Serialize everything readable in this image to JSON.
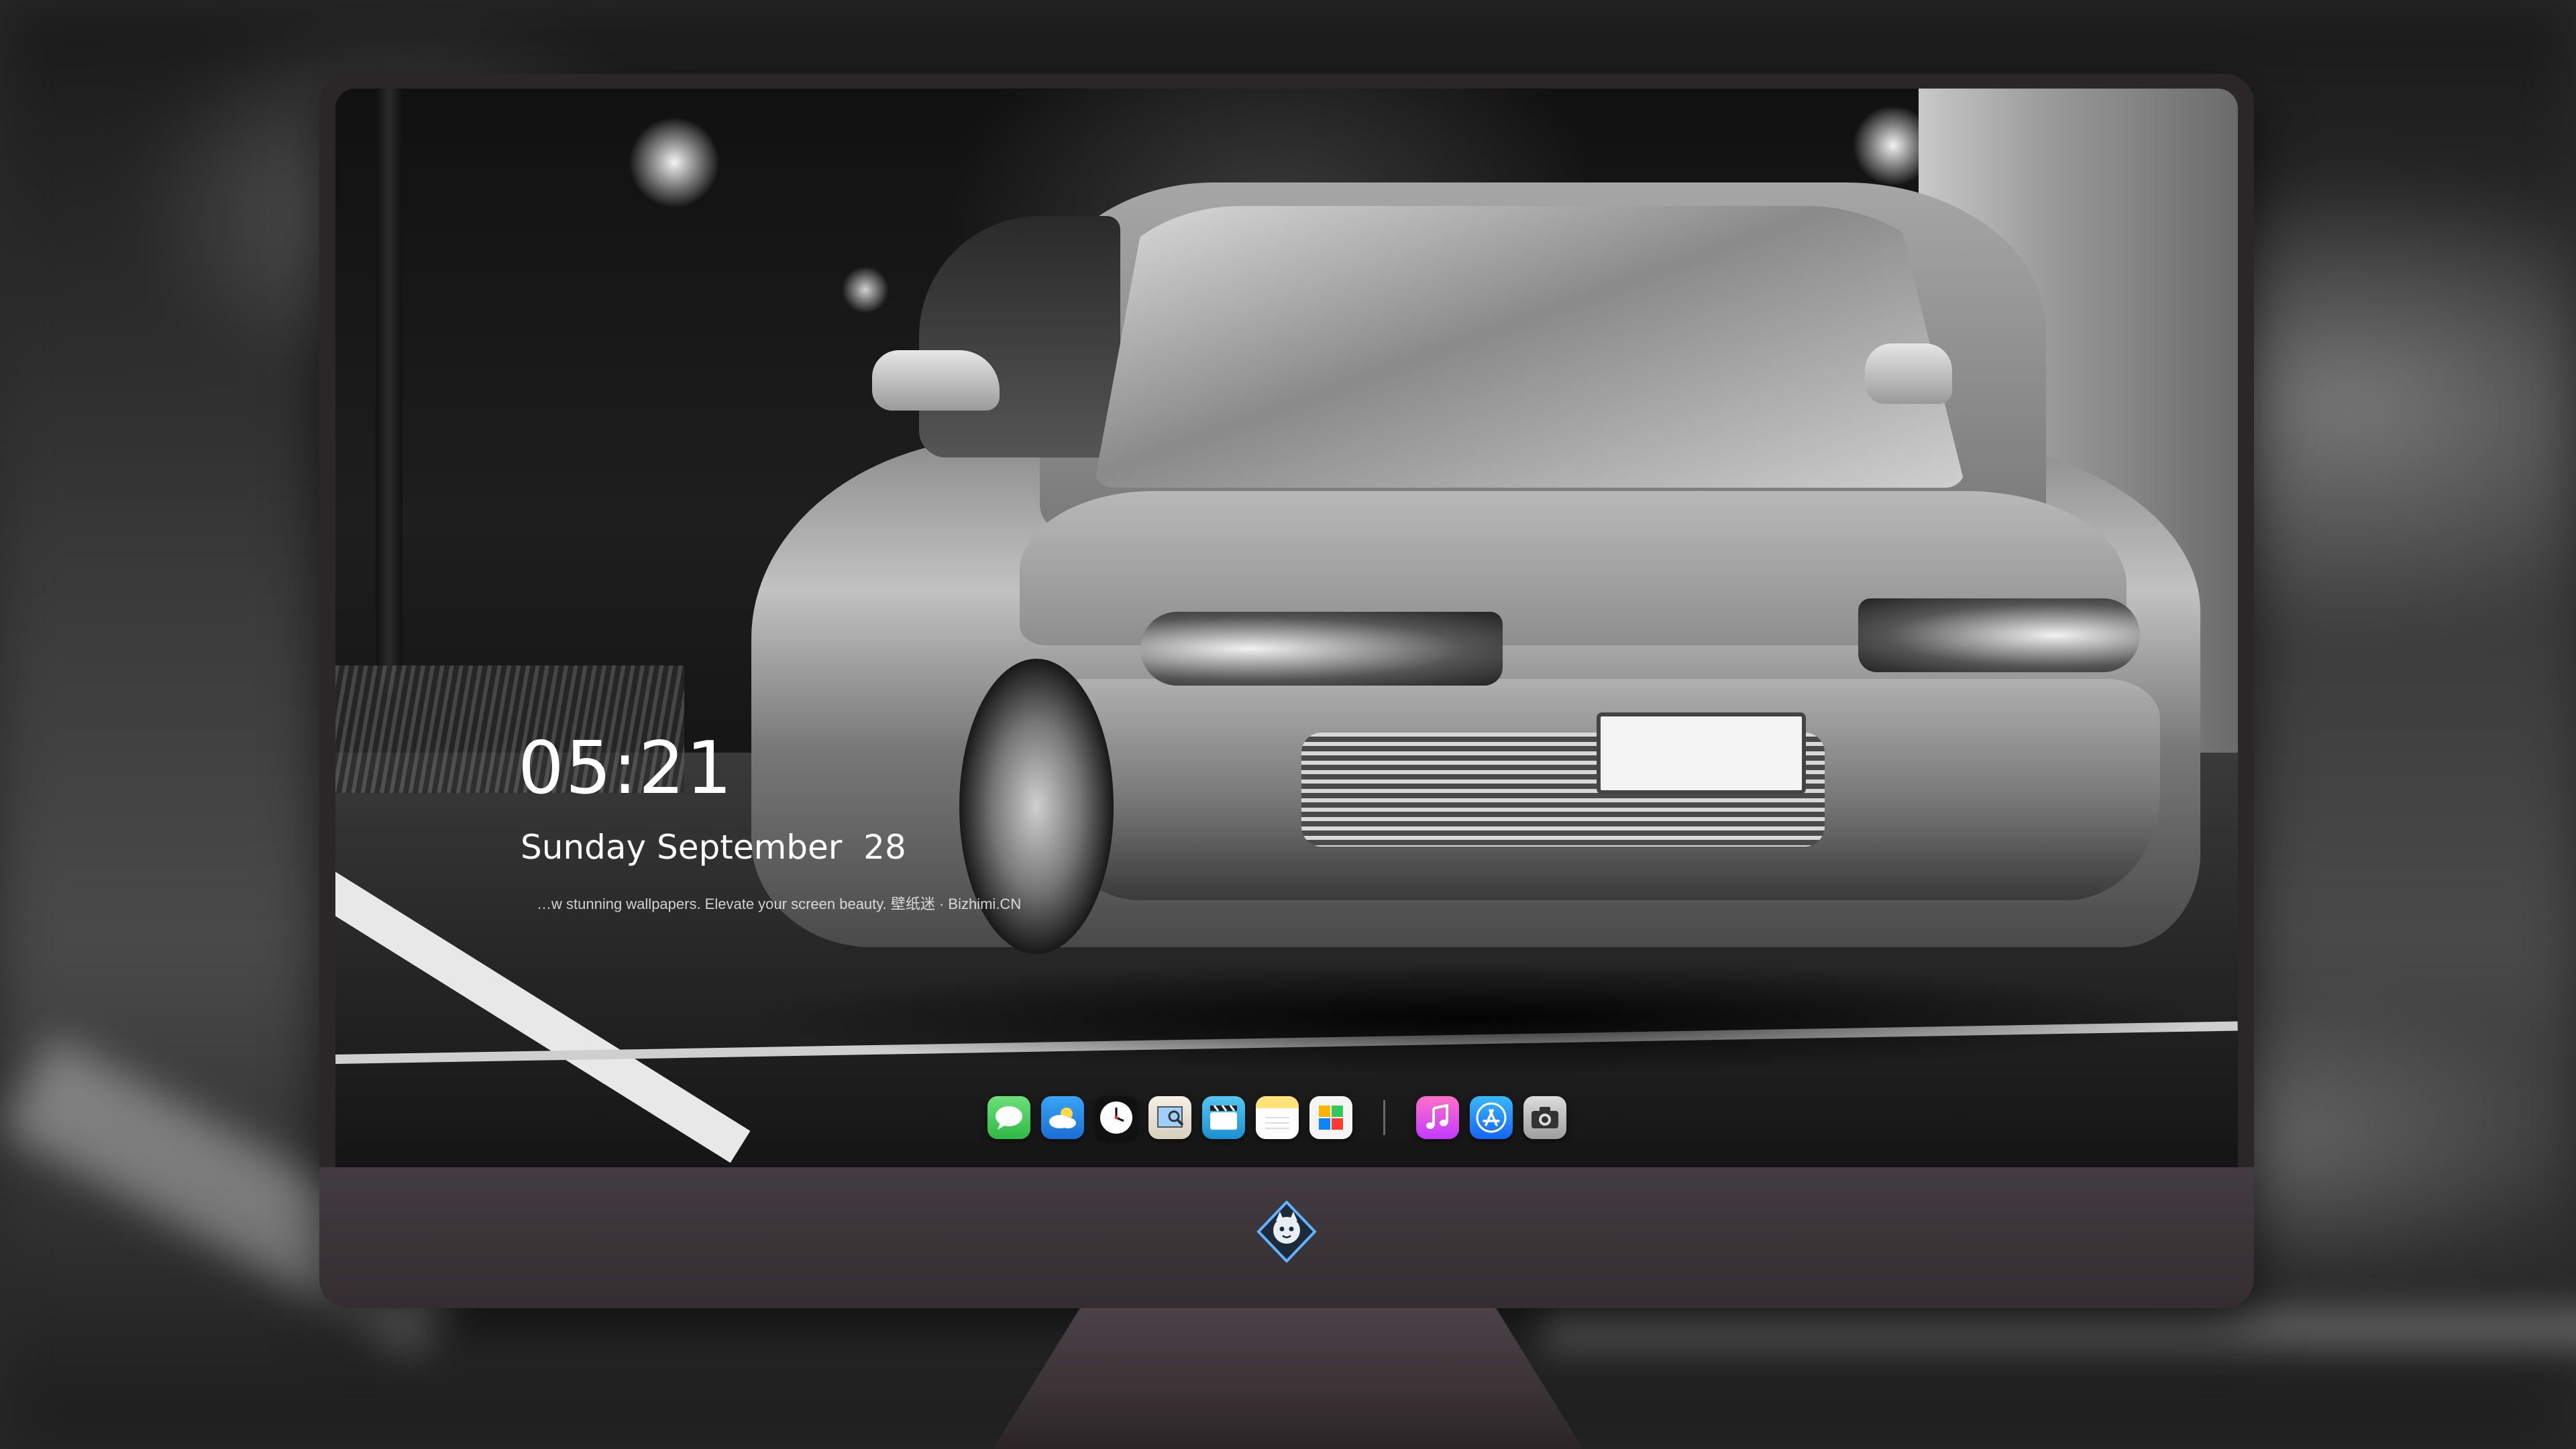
{
  "lock_screen": {
    "time": "05:21",
    "date": "Sunday September  28",
    "tagline": "…w stunning wallpapers. Elevate your screen beauty. 壁纸迷 · Bizhimi.CN"
  },
  "dock": {
    "apps": [
      {
        "icon": "messages-icon"
      },
      {
        "icon": "weather-icon"
      },
      {
        "icon": "clock-icon"
      },
      {
        "icon": "preview-icon"
      },
      {
        "icon": "video-icon"
      },
      {
        "icon": "notes-icon"
      },
      {
        "icon": "photos-icon"
      },
      {
        "icon": "music-icon"
      },
      {
        "icon": "app-store-icon"
      },
      {
        "icon": "camera-icon"
      }
    ]
  },
  "colors": {
    "monitor_frame": "#2b2628",
    "chin": "#3b3438",
    "text": "#ffffff"
  }
}
